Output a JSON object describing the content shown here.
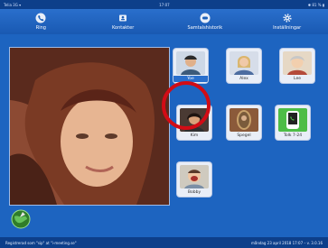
{
  "statusbar": {
    "left": "Telia 3G ▾",
    "center": "17:07",
    "right": "✱ 81 % ▮"
  },
  "toolbar": [
    {
      "label": "Ring",
      "icon": "phone-icon"
    },
    {
      "label": "Kontakter",
      "icon": "contacts-icon"
    },
    {
      "label": "Samtalshistorik",
      "icon": "history-icon"
    },
    {
      "label": "Inställningar",
      "icon": "settings-icon"
    }
  ],
  "contacts": [
    {
      "name": "Yoe"
    },
    {
      "name": "Alex"
    },
    {
      "name": "Lee"
    },
    {
      "name": "Kim"
    },
    {
      "name": "Spegel"
    },
    {
      "name": "Tolk 7-24"
    },
    {
      "name": "Bobby"
    }
  ],
  "footer": {
    "left": "Registrerad som \"sip\" at \"i-meeting.se\"",
    "right": "måndag 23 april 2018 17:07 – v. 3.0.16"
  },
  "colors": {
    "brand_blue": "#1d64c0",
    "highlight_ring": "#d20c15"
  }
}
